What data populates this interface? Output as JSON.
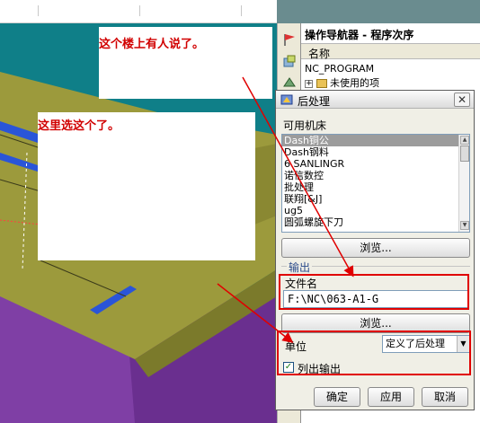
{
  "navigator": {
    "title": "操作导航器 - 程序次序",
    "column_header": "名称",
    "rows": [
      {
        "label": "NC_PROGRAM"
      },
      {
        "label": "未使用的项"
      }
    ]
  },
  "annotations": {
    "note1": "这个楼上有人说了。",
    "note2": "这里选这个了。"
  },
  "dialog": {
    "title": "后处理",
    "machines_label": "可用机床",
    "machines": [
      {
        "label": "Dash铜公",
        "selected": true
      },
      {
        "label": "Dash钢料",
        "selected": false
      },
      {
        "label": "6 SANLINGR",
        "selected": false
      },
      {
        "label": "诺信数控",
        "selected": false
      },
      {
        "label": "批处理",
        "selected": false
      },
      {
        "label": "联翔[&J]",
        "selected": false
      },
      {
        "label": "ug5",
        "selected": false
      },
      {
        "label": "圆弧螺旋下刀",
        "selected": false
      }
    ],
    "browse_label": "浏览...",
    "output_group_label": "输出",
    "filename_label": "文件名",
    "filename_value": "F:\\NC\\063-A1-G",
    "browse2_label": "浏览...",
    "unit_label": "单位",
    "unit_value": "定义了后处理",
    "list_output_label": "列出输出",
    "list_output_checked": true,
    "ok_label": "确定",
    "apply_label": "应用",
    "cancel_label": "取消"
  },
  "colors": {
    "annotation_red": "#e00000",
    "cad_green": "#9c9a3c",
    "cad_purple": "#7f3fa2",
    "cad_blue": "#2a55d8"
  },
  "icons": {
    "dialog_title": "post-process-icon",
    "dialog_close": "close-icon",
    "nav_expand": "plus-icon",
    "nav_folder": "folder-icon"
  }
}
